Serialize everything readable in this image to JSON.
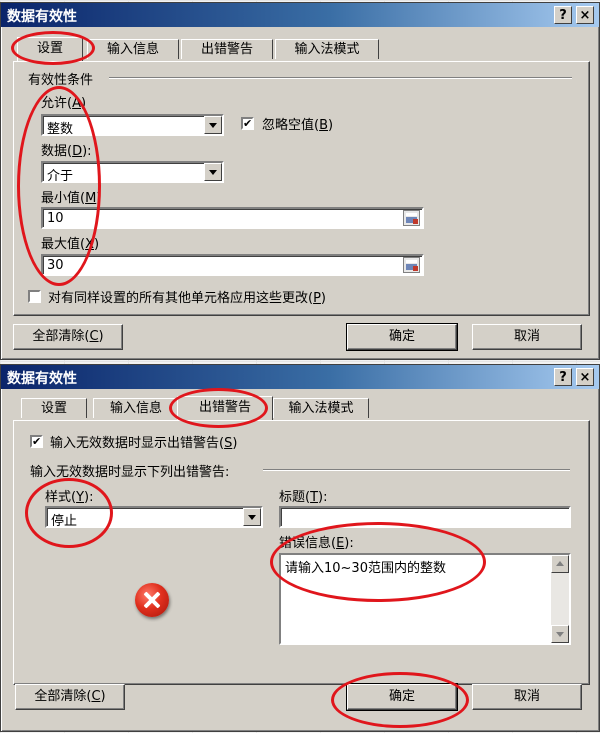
{
  "accent": {
    "title_bar": "#0a246a",
    "annotation": "#e0161c",
    "dialog_face": "#d4d0c8"
  },
  "dialog1": {
    "title": "数据有效性",
    "help_glyph": "?",
    "close_glyph": "×",
    "tabs": [
      {
        "label": "设置",
        "active": true
      },
      {
        "label": "输入信息",
        "active": false
      },
      {
        "label": "出错警告",
        "active": false
      },
      {
        "label": "输入法模式",
        "active": false
      }
    ],
    "group_title": "有效性条件",
    "allow_label": "允许(",
    "allow_key": "A",
    "allow_label_end": ")",
    "allow_value": "整数",
    "ignore_blank": {
      "label": "忽略空值(",
      "key": "B",
      "label_end": ")",
      "checked": true
    },
    "data_label": "数据(",
    "data_key": "D",
    "data_label_end": "):",
    "data_value": "介于",
    "min_label": "最小值(",
    "min_key": "M",
    "min_label_end": ")",
    "min_value": "10",
    "max_label": "最大值(",
    "max_key": "X",
    "max_label_end": ")",
    "max_value": "30",
    "apply_all": {
      "label": "对有同样设置的所有其他单元格应用这些更改(",
      "key": "P",
      "label_end": ")",
      "checked": false
    },
    "clear_all": {
      "label": "全部清除(",
      "key": "C",
      "label_end": ")"
    },
    "ok_label": "确定",
    "cancel_label": "取消"
  },
  "dialog2": {
    "title": "数据有效性",
    "help_glyph": "?",
    "close_glyph": "×",
    "tabs": [
      {
        "label": "设置",
        "active": false
      },
      {
        "label": "输入信息",
        "active": false
      },
      {
        "label": "出错警告",
        "active": true
      },
      {
        "label": "输入法模式",
        "active": false
      }
    ],
    "show_error": {
      "label": "输入无效数据时显示出错警告(",
      "key": "S",
      "label_end": ")",
      "checked": true
    },
    "section_title": "输入无效数据时显示下列出错警告:",
    "style_label": "样式(",
    "style_key": "Y",
    "style_label_end": "):",
    "style_value": "停止",
    "title_label": "标题(",
    "title_key": "T",
    "title_label_end": "):",
    "title_value": "",
    "message_label": "错误信息(",
    "message_key": "E",
    "message_label_end": "):",
    "message_value": "请输入10~30范围内的整数",
    "clear_all": {
      "label": "全部清除(",
      "key": "C",
      "label_end": ")"
    },
    "ok_label": "确定",
    "cancel_label": "取消"
  }
}
